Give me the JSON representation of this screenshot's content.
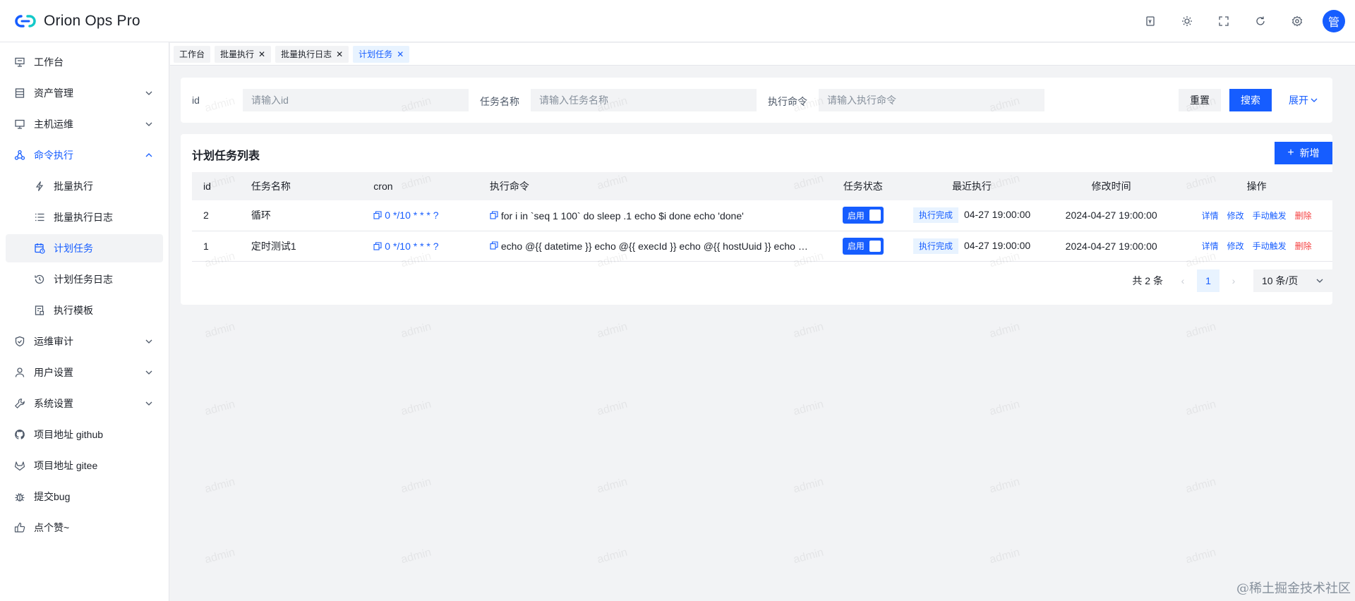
{
  "app": {
    "title": "Orion Ops Pro",
    "avatar_text": "管"
  },
  "header_icons": [
    "document-icon",
    "theme-icon",
    "fullscreen-icon",
    "refresh-icon",
    "settings-icon"
  ],
  "sidebar": {
    "items": [
      {
        "label": "工作台",
        "icon": "monitor-icon"
      },
      {
        "label": "资产管理",
        "icon": "list-icon"
      },
      {
        "label": "主机运维",
        "icon": "desktop-icon"
      },
      {
        "label": "命令执行",
        "icon": "nodes-icon"
      },
      {
        "label": "运维审计",
        "icon": "shield-icon"
      },
      {
        "label": "用户设置",
        "icon": "user-icon"
      },
      {
        "label": "系统设置",
        "icon": "tool-icon"
      },
      {
        "label": "项目地址 github",
        "icon": "github-icon"
      },
      {
        "label": "项目地址 gitee",
        "icon": "gitee-icon"
      },
      {
        "label": "提交bug",
        "icon": "bug-icon"
      },
      {
        "label": "点个赞~",
        "icon": "thumb-up-icon"
      }
    ],
    "submenu": [
      {
        "label": "批量执行",
        "icon": "thunder-icon"
      },
      {
        "label": "批量执行日志",
        "icon": "ordered-list-icon"
      },
      {
        "label": "计划任务",
        "icon": "calendar-clock-icon"
      },
      {
        "label": "计划任务日志",
        "icon": "history-icon"
      },
      {
        "label": "执行模板",
        "icon": "template-icon"
      }
    ]
  },
  "tabs": [
    {
      "label": "工作台",
      "closable": false
    },
    {
      "label": "批量执行",
      "closable": true
    },
    {
      "label": "批量执行日志",
      "closable": true
    },
    {
      "label": "计划任务",
      "closable": true
    }
  ],
  "search": {
    "id_label": "id",
    "id_placeholder": "请输入id",
    "name_label": "任务名称",
    "name_placeholder": "请输入任务名称",
    "command_label": "执行命令",
    "command_placeholder": "请输入执行命令",
    "reset_label": "重置",
    "search_label": "搜索",
    "expand_label": "展开"
  },
  "table": {
    "title": "计划任务列表",
    "add_label": "新增",
    "columns": [
      "id",
      "任务名称",
      "cron",
      "执行命令",
      "任务状态",
      "最近执行",
      "修改时间",
      "操作"
    ],
    "rows": [
      {
        "id": "2",
        "name": "循环",
        "cron": "0 */10 * * * ?",
        "command": "for i in `seq 1 100` do sleep .1 echo $i done echo 'done'",
        "status": "启用",
        "last_exec_tag": "执行完成",
        "last_exec_time": "04-27 19:00:00",
        "modified": "2024-04-27 19:00:00"
      },
      {
        "id": "1",
        "name": "定时测试1",
        "cron": "0 */10 * * * ?",
        "command": "echo @{{ datetime }} echo @{{ execId }} echo @{{ hostUuid }} echo @{{ hostName }}",
        "status": "启用",
        "last_exec_tag": "执行完成",
        "last_exec_time": "04-27 19:00:00",
        "modified": "2024-04-27 19:00:00"
      }
    ],
    "actions": {
      "detail": "详情",
      "edit": "修改",
      "trigger": "手动触发",
      "delete": "删除"
    }
  },
  "pagination": {
    "total": "共 2 条",
    "current": "1",
    "page_size": "10 条/页"
  },
  "watermark_text": "admin",
  "footer_mark": "@稀土掘金技术社区",
  "colors": {
    "primary": "#165dff",
    "danger": "#f53f3f",
    "bg": "#f2f3f5"
  }
}
